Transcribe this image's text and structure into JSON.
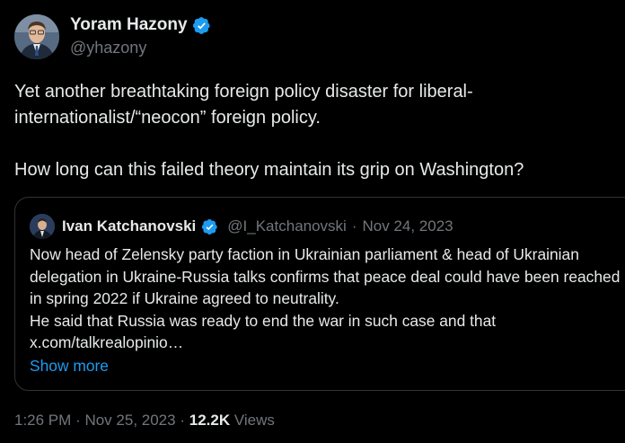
{
  "tweet": {
    "author_name": "Yoram Hazony",
    "author_handle": "@yhazony",
    "text": "Yet another breathtaking foreign policy disaster for liberal-\ninternationalist/“neocon” foreign policy.\n\nHow long can this failed theory maintain its grip on Washington?",
    "time": "1:26 PM",
    "date": "Nov 25, 2023",
    "views_count": "12.2K",
    "views_label": "Views",
    "separator": "·"
  },
  "quoted": {
    "author_name": "Ivan Katchanovski",
    "author_handle": "@I_Katchanovski",
    "date": "Nov 24, 2023",
    "separator": "·",
    "text": "Now head of Zelensky party faction in Ukrainian parliament & head of Ukrainian delegation in Ukraine-Russia talks confirms that peace deal could have been reached in spring 2022 if Ukraine agreed to neutrality.",
    "text2": "He said that Russia was ready to end the war in such case and that",
    "link": "x.com/talkrealopinio…",
    "show_more": "Show more"
  },
  "colors": {
    "background": "#000000",
    "text": "#e7e9ea",
    "muted": "#71767b",
    "accent": "#1d9bf0",
    "border": "#2f3336"
  },
  "icons": {
    "verified": "verified-badge-icon"
  }
}
